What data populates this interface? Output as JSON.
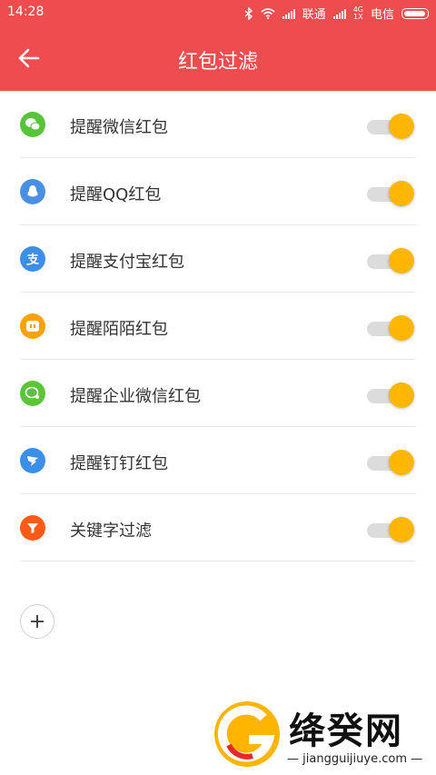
{
  "status": {
    "time": "14:28",
    "carrier1": "联通",
    "carrier2": "电信",
    "net": "4G",
    "net2": "1X"
  },
  "header": {
    "title": "红包过滤"
  },
  "colors": {
    "accent": "#ef4c4f",
    "toggle_on": "#ffb600"
  },
  "items": [
    {
      "label": "提醒微信红包",
      "icon": "wechat-icon",
      "icon_color": "#58c43b",
      "enabled": true
    },
    {
      "label": "提醒QQ红包",
      "icon": "qq-icon",
      "icon_color": "#4a90e2",
      "enabled": true
    },
    {
      "label": "提醒支付宝红包",
      "icon": "alipay-icon",
      "icon_color": "#3d8ee6",
      "enabled": true
    },
    {
      "label": "提醒陌陌红包",
      "icon": "momo-icon",
      "icon_color": "#ffa200",
      "enabled": true
    },
    {
      "label": "提醒企业微信红包",
      "icon": "wework-icon",
      "icon_color": "#5cc43b",
      "enabled": true
    },
    {
      "label": "提醒钉钉红包",
      "icon": "dingtalk-icon",
      "icon_color": "#3d8ee6",
      "enabled": true
    },
    {
      "label": "关键字过滤",
      "icon": "filter-icon",
      "icon_color": "#ff5a16",
      "enabled": true
    }
  ],
  "watermark": {
    "name": "绛癸网",
    "url": "jiangguijiuye.com"
  }
}
